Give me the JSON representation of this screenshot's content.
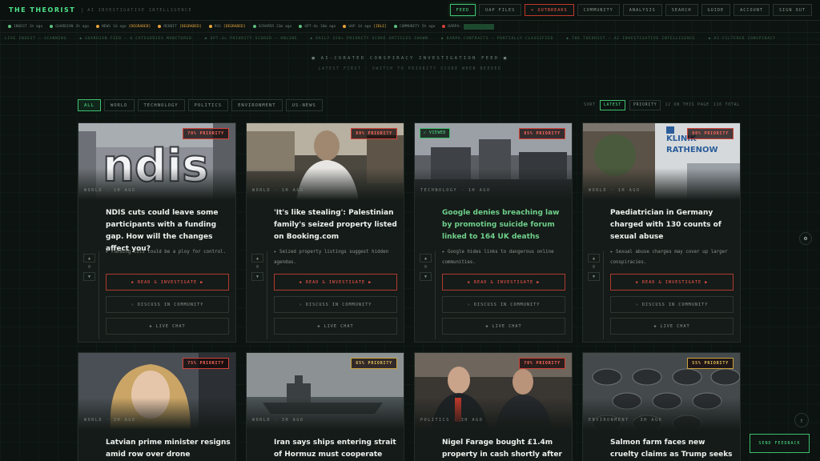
{
  "app": {
    "brand": "THE THEORIST",
    "tagline": "AI INVESTIGATIVE INTELLIGENCE"
  },
  "nav": [
    "FEED",
    "UAP FILES",
    "+ OUTBREAKS",
    "COMMUNITY",
    "ANALYSIS",
    "SEARCH",
    "GUIDE",
    "ACCOUNT",
    "SIGN OUT"
  ],
  "status": [
    {
      "label": "INGEST",
      "value": "1h ago",
      "color": "#5fbf80",
      "tag": ""
    },
    {
      "label": "GUARDIAN",
      "value": "2h ago",
      "color": "#5fbf80",
      "tag": ""
    },
    {
      "label": "NEWS",
      "value": "1d ago",
      "color": "#e8a33d",
      "tag": "[DEGRADED]"
    },
    {
      "label": "REDDIT",
      "value": "",
      "color": "#e8a33d",
      "tag": "[DEGRADED]"
    },
    {
      "label": "RSS",
      "value": "",
      "color": "#e8a33d",
      "tag": "[DEGRADED]"
    },
    {
      "label": "SCRAPER",
      "value": "23m ago",
      "color": "#5fbf80",
      "tag": ""
    },
    {
      "label": "GPT-4o",
      "value": "18m ago",
      "color": "#5fbf80",
      "tag": ""
    },
    {
      "label": "UAP",
      "value": "1d ago",
      "color": "#e8a33d",
      "tag": "[IDLE]"
    },
    {
      "label": "COMMUNITY",
      "value": "5h ago",
      "color": "#5fbf80",
      "tag": ""
    },
    {
      "label": "DARPA:",
      "value": "",
      "color": "#d2433a",
      "tag": ""
    }
  ],
  "ticker": [
    "LIVE INGEST — SCANNING",
    "◆ GUARDIAN FEED — 6 CATEGORIES MONITORED",
    "◆ GPT-4o PRIORITY SCORER — ONLINE",
    "◆ DAILY 150+ PRIORITY SCORE ARTICLES SHOWN",
    "◆ DARPA CONTRACTS — PARTIALLY CLASSIFIED",
    "◆ THE THEORIST — AI INVESTIGATIVE INTELLIGENCE",
    "◆ AI-FILTERED CONSPIRACY"
  ],
  "hero": {
    "title": "■ AI-CURATED CONSPIRACY INVESTIGATION FEED ■",
    "subtitle": "LATEST FIRST · SWITCH TO PRIORITY SCORE WHEN NEEDED"
  },
  "filters": [
    "ALL",
    "WORLD",
    "TECHNOLOGY",
    "POLITICS",
    "ENVIRONMENT",
    "US-NEWS"
  ],
  "sort": {
    "label": "SORT",
    "latest": "LATEST",
    "priority": "PRIORITY",
    "count": "12 ON THIS PAGE",
    "total": "116 TOTAL"
  },
  "buttons": {
    "read": "◈ READ & INVESTIGATE ▶",
    "discuss": "› DISCUSS IN COMMUNITY",
    "chat": "◈ LIVE CHAT"
  },
  "cards": [
    {
      "priority": "70% PRIORITY",
      "amber": false,
      "viewed": "",
      "meta": "WORLD · 1H AGO",
      "title": "NDIS cuts could leave some participants with a funding gap. How will the changes affect you?",
      "bullet": "▸ Funding cuts could be a ploy for control.",
      "votes": "0",
      "img": "ndis"
    },
    {
      "priority": "80% PRIORITY",
      "amber": false,
      "viewed": "",
      "meta": "WORLD · 1H AGO",
      "title": "'It's like stealing': Palestinian family's seized property listed on Booking.com",
      "bullet": "▸ Seized property listings suggest hidden agendas.",
      "votes": "0",
      "img": "man"
    },
    {
      "priority": "85% PRIORITY",
      "amber": false,
      "viewed": "✓ VIEWED",
      "meta": "TECHNOLOGY · 1H AGO",
      "title": "Google denies breaching law by promoting suicide forum linked to 164 UK deaths",
      "bullet": "▸ Google hides links to dangerous online communities.",
      "votes": "0",
      "img": "city"
    },
    {
      "priority": "90% PRIORITY",
      "amber": false,
      "viewed": "",
      "meta": "WORLD · 1H AGO",
      "title": "Paediatrician in Germany charged with 130 counts of sexual abuse",
      "bullet": "▸ Sexual abuse charges may cover up larger conspiracies.",
      "votes": "0",
      "img": "klinik"
    },
    {
      "priority": "75% PRIORITY",
      "amber": false,
      "viewed": "",
      "meta": "WORLD · 3H AGO",
      "title": "Latvian prime minister resigns amid row over drone incursions",
      "bullet": "",
      "votes": "0",
      "img": "woman"
    },
    {
      "priority": "65% PRIORITY",
      "amber": true,
      "viewed": "",
      "meta": "WORLD · 3H AGO",
      "title": "Iran says ships entering strait of Hormuz must cooperate after",
      "bullet": "",
      "votes": "0",
      "img": "ship"
    },
    {
      "priority": "70% PRIORITY",
      "amber": false,
      "viewed": "",
      "meta": "POLITICS · 3H AGO",
      "title": "Nigel Farage bought £1.4m property in cash shortly after",
      "bullet": "",
      "votes": "0",
      "img": "men"
    },
    {
      "priority": "55% PRIORITY",
      "amber": true,
      "viewed": "",
      "meta": "ENVIRONMENT · 3H AGO",
      "title": "Salmon farm faces new cruelty claims as Trump seeks to",
      "bullet": "",
      "votes": "0",
      "img": "fish"
    }
  ],
  "feedback": "SEND FEEDBACK",
  "icons": {
    "top": "arrow-up-icon",
    "side": "sliders-icon"
  }
}
